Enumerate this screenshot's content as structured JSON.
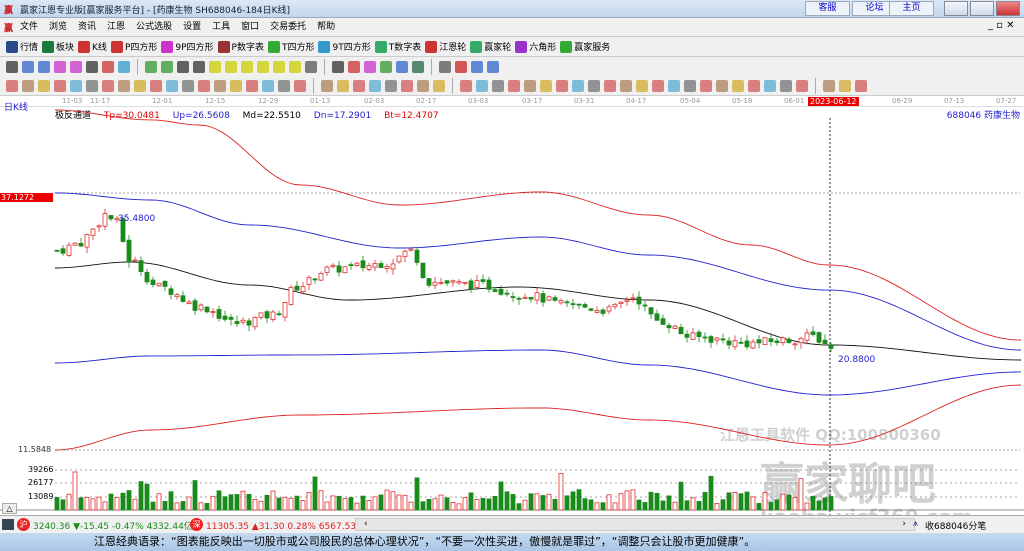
{
  "window": {
    "title": "赢家江恩专业版[赢家服务平台] - [药康生物  SH688046-184日K线]",
    "links": [
      "客服",
      "论坛",
      "主页"
    ]
  },
  "menu": [
    "文件",
    "浏览",
    "资讯",
    "江恩",
    "公式选股",
    "设置",
    "工具",
    "窗口",
    "交易委托",
    "帮助"
  ],
  "toolbar1": [
    {
      "label": "行情",
      "icon": "quote-grid-icon",
      "color": "#2a4a8a"
    },
    {
      "label": "板块",
      "icon": "sector-icon",
      "color": "#1a7a3a"
    },
    {
      "label": "K线",
      "icon": "kline-icon",
      "color": "#c33"
    },
    {
      "label": "P四方形",
      "icon": "ps-icon",
      "color": "#c33"
    },
    {
      "label": "9P四方形",
      "icon": "p9-icon",
      "color": "#c3c"
    },
    {
      "label": "P数字表",
      "icon": "pn-icon",
      "color": "#933"
    },
    {
      "label": "T四方形",
      "icon": "ts-icon",
      "color": "#3a3"
    },
    {
      "label": "9T四方形",
      "icon": "t9-icon",
      "color": "#39c"
    },
    {
      "label": "T数字表",
      "icon": "tn-icon",
      "color": "#3a6"
    },
    {
      "label": "江恩轮",
      "icon": "gann-wheel-icon",
      "color": "#c33"
    },
    {
      "label": "赢家轮",
      "icon": "winner-wheel-icon",
      "color": "#3a6"
    },
    {
      "label": "六角形",
      "icon": "hexagon-icon",
      "color": "#93c"
    },
    {
      "label": "赢家服务",
      "icon": "dollar-icon",
      "color": "#3a3"
    }
  ],
  "chart": {
    "period_label": "日K线",
    "indicator": {
      "name": "极反通道",
      "tp": "Tp=30.0481",
      "up": "Up=26.5608",
      "md": "Md=22.5510",
      "dn": "Dn=17.2901",
      "bt": "Bt=12.4707"
    },
    "stock_label": "688046 药康生物",
    "dates": [
      "11-03",
      "11-17",
      "12-01",
      "12-15",
      "12-29",
      "01-13",
      "02-03",
      "02-17",
      "03-03",
      "03-17",
      "03-31",
      "04-17",
      "05-04",
      "05-18",
      "06-01",
      "06-29",
      "07-13",
      "07-27"
    ],
    "cursor_date": "2023-06-12",
    "price_ref": "37.1272",
    "price_low_ref": "11.5848",
    "high_label": "35.4800",
    "low_label": "20.8800",
    "vol_ticks": [
      "39266",
      "26177",
      "13089"
    ],
    "watermark1": "江恩工具软件  QQ:100800360",
    "watermark2": "赢家聊吧",
    "watermark3": "liaoba.yjcf360.com"
  },
  "chart_data": {
    "type": "candlestick",
    "close_keypoints": [
      [
        0,
        31.4
      ],
      [
        4,
        32.2
      ],
      [
        6,
        33.5
      ],
      [
        8,
        35.0
      ],
      [
        10,
        34.2
      ],
      [
        12,
        30.5
      ],
      [
        17,
        27.8
      ],
      [
        24,
        25.8
      ],
      [
        30,
        24.2
      ],
      [
        36,
        25.0
      ],
      [
        40,
        27.8
      ],
      [
        45,
        29.5
      ],
      [
        50,
        29.8
      ],
      [
        55,
        30.2
      ],
      [
        59,
        31.4
      ],
      [
        62,
        28.3
      ],
      [
        70,
        28.0
      ],
      [
        78,
        27.0
      ],
      [
        85,
        26.0
      ],
      [
        92,
        25.5
      ],
      [
        96,
        26.8
      ],
      [
        100,
        24.5
      ],
      [
        106,
        22.8
      ],
      [
        115,
        22.2
      ],
      [
        122,
        22.5
      ],
      [
        126,
        22.9
      ],
      [
        129,
        21.9
      ]
    ],
    "channels": [
      {
        "name": "Tp",
        "color": "#d22",
        "points": [
          [
            0,
            45.38
          ],
          [
            16,
            44.39
          ],
          [
            24,
            43.89
          ],
          [
            41,
            37.92
          ],
          [
            57.5,
            35.93
          ],
          [
            81,
            37.23
          ],
          [
            99,
            34.94
          ],
          [
            116,
            31.96
          ],
          [
            129,
            29.97
          ],
          [
            161,
            22.51
          ]
        ]
      },
      {
        "name": "Up",
        "color": "#22c",
        "points": [
          [
            0,
            37.13
          ],
          [
            16,
            36.43
          ],
          [
            32.5,
            33.95
          ],
          [
            57.5,
            31.66
          ],
          [
            81,
            32.75
          ],
          [
            99,
            30.96
          ],
          [
            129,
            27.48
          ],
          [
            161,
            21.52
          ]
        ]
      },
      {
        "name": "Md",
        "color": "#111",
        "points": [
          [
            0,
            29.67
          ],
          [
            12.5,
            30.27
          ],
          [
            32.5,
            27.98
          ],
          [
            49,
            26.49
          ],
          [
            77.5,
            27.78
          ],
          [
            99,
            26.49
          ],
          [
            129,
            22.02
          ],
          [
            161,
            20.53
          ]
        ]
      },
      {
        "name": "Dn",
        "color": "#22c",
        "points": [
          [
            0,
            20.23
          ],
          [
            16,
            20.93
          ],
          [
            41,
            21.03
          ],
          [
            81,
            21.52
          ],
          [
            99,
            20.03
          ],
          [
            129,
            17.05
          ],
          [
            161,
            19.34
          ]
        ]
      },
      {
        "name": "Bt",
        "color": "#d22",
        "points": [
          [
            0,
            11.58
          ],
          [
            16,
            13.57
          ],
          [
            41,
            15.06
          ],
          [
            81,
            15.76
          ],
          [
            99,
            14.56
          ],
          [
            129,
            12.08
          ],
          [
            161,
            18.04
          ]
        ]
      }
    ],
    "ylim": [
      11.5848,
      37.1272
    ]
  },
  "status": {
    "sh_index": "3240.36 ▼-15.45 -0.47% 4332.44亿",
    "sz_index": "11305.35 ▲31.30 0.28% 6567.53亿",
    "right": "收688046分笔"
  },
  "quote": "江恩经典语录：“图表能反映出一切股市或公司股民的总体心理状况”，“不要一次性买进，傲慢就是罪过”，“调整只会让股市更加健康”。"
}
